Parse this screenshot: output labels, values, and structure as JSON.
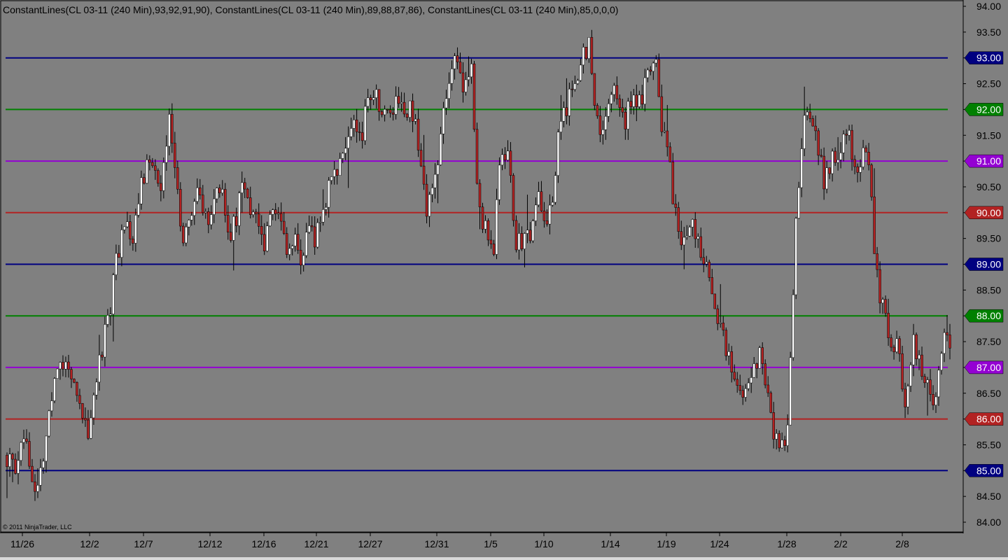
{
  "chart_title": "ConstantLines(CL  03-11  (240  Min),93,92,91,90),  ConstantLines(CL  03-11  (240  Min),89,88,87,86),  ConstantLines(CL  03-11  (240  Min),85,0,0,0)",
  "copyright": "© 2011 NinjaTrader, LLC",
  "colors": {
    "background": "#808080",
    "up_candle": "#ffffff",
    "down_candle": "#b22222",
    "candle_outline": "#000000",
    "navy": "#000080",
    "green": "#008000",
    "purple": "#9400d3",
    "red": "#b22222"
  },
  "chart_data": {
    "type": "candlestick",
    "symbol": "CL 03-11",
    "interval": "240 Min",
    "ylim": [
      84.0,
      94.0
    ],
    "y_ticks": [
      "94.00",
      "93.50",
      "93.00",
      "92.50",
      "92.00",
      "91.50",
      "91.00",
      "90.50",
      "90.00",
      "89.50",
      "89.00",
      "88.50",
      "88.00",
      "87.50",
      "87.00",
      "86.50",
      "86.00",
      "85.50",
      "85.00",
      "84.50",
      "84.00"
    ],
    "x_ticks": [
      "11/26",
      "12/2",
      "12/7",
      "12/12",
      "12/16",
      "12/21",
      "12/27",
      "12/31",
      "1/5",
      "1/10",
      "1/14",
      "1/19",
      "1/24",
      "1/28",
      "2/2",
      "2/8"
    ],
    "constant_lines": [
      {
        "value": 93,
        "label": "93.00",
        "color": "navy"
      },
      {
        "value": 92,
        "label": "92.00",
        "color": "green"
      },
      {
        "value": 91,
        "label": "91.00",
        "color": "purple"
      },
      {
        "value": 90,
        "label": "90.00",
        "color": "red"
      },
      {
        "value": 89,
        "label": "89.00",
        "color": "navy"
      },
      {
        "value": 88,
        "label": "88.00",
        "color": "green"
      },
      {
        "value": 87,
        "label": "87.00",
        "color": "purple"
      },
      {
        "value": 86,
        "label": "86.00",
        "color": "red"
      },
      {
        "value": 85,
        "label": "85.00",
        "color": "navy"
      }
    ],
    "price_path": [
      85.3,
      85.0,
      85.8,
      85.2,
      84.7,
      85.4,
      86.2,
      87.0,
      87.3,
      86.8,
      86.2,
      85.7,
      86.6,
      87.4,
      88.2,
      89.2,
      89.7,
      89.5,
      90.3,
      91.0,
      90.8,
      90.5,
      91.8,
      90.4,
      89.4,
      90.0,
      90.6,
      89.8,
      90.1,
      90.5,
      89.5,
      89.8,
      90.6,
      90.1,
      90.0,
      89.4,
      90.2,
      89.8,
      89.3,
      89.6,
      89.1,
      89.7,
      89.5,
      90.1,
      90.6,
      91.0,
      91.3,
      91.7,
      91.4,
      92.2,
      92.3,
      91.8,
      92.0,
      92.3,
      92.1,
      91.9,
      91.3,
      90.1,
      90.5,
      91.8,
      92.3,
      93.0,
      92.4,
      93.0,
      90.0,
      89.7,
      89.0,
      91.2,
      91.2,
      89.5,
      89.3,
      89.6,
      90.4,
      89.8,
      90.2,
      91.8,
      92.0,
      92.5,
      93.0,
      93.2,
      91.8,
      91.4,
      92.5,
      92.1,
      91.8,
      92.4,
      92.0,
      92.7,
      93.0,
      91.6,
      90.9,
      89.6,
      89.5,
      89.9,
      89.2,
      89.0,
      88.0,
      87.6,
      87.2,
      86.5,
      86.3,
      86.8,
      87.3,
      86.8,
      85.8,
      85.4,
      85.9,
      89.5,
      91.6,
      92.0,
      91.2,
      90.6,
      91.0,
      91.2,
      91.6,
      90.9,
      91.1,
      90.9,
      88.8,
      88.1,
      87.3,
      87.4,
      86.2,
      87.6,
      87.1,
      86.8,
      86.3,
      87.6,
      87.3
    ]
  }
}
